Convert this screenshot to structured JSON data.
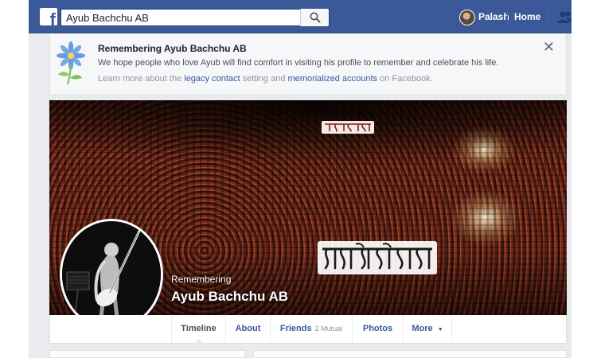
{
  "topbar": {
    "logo_letter": "f",
    "search": {
      "value": "Ayub Bachchu AB",
      "placeholder": "Search"
    },
    "user_name": "Palash",
    "home_label": "Home",
    "brand_color": "#3b5998"
  },
  "banner": {
    "title": "Remembering Ayub Bachchu AB",
    "text": "We hope people who love Ayub will find comfort in visiting his profile to remember and celebrate his life.",
    "learn_prefix": "Learn more about the ",
    "legacy_link": "legacy contact",
    "learn_middle": " setting and ",
    "memorialized_link": "memorialized accounts",
    "learn_suffix": " on Facebook.",
    "close_glyph": "✕"
  },
  "cover": {
    "remembering_label": "Remembering",
    "profile_name": "Ayub Bachchu AB",
    "watermark": "দৈনিক আকাশ"
  },
  "tabs": [
    {
      "label": "Timeline",
      "active": true
    },
    {
      "label": "About"
    },
    {
      "label": "Friends",
      "sub": "2 Mutual"
    },
    {
      "label": "Photos"
    },
    {
      "label": "More",
      "caret": "▼"
    }
  ],
  "icons": {
    "search": "search-icon",
    "friends": "friend-requests-icon",
    "close": "close-icon",
    "flower": "remembering-flower-icon",
    "legacy": "legacy-badge-icon"
  }
}
